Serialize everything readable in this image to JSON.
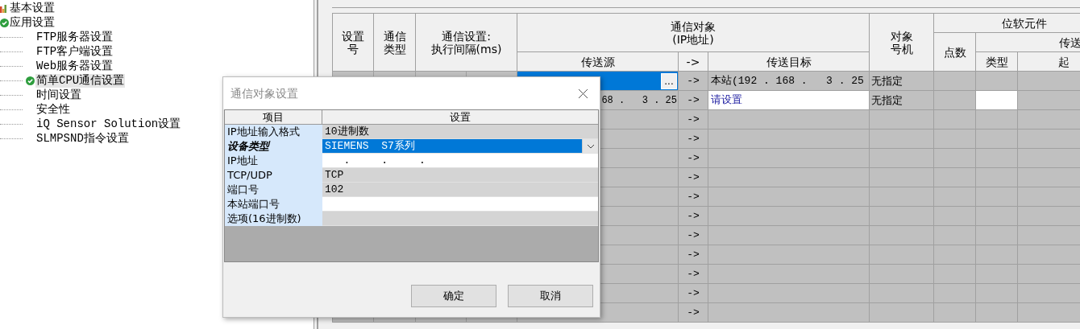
{
  "tree": [
    {
      "label": "基本设置",
      "kind": "chart",
      "selected": false
    },
    {
      "label": "应用设置",
      "kind": "check",
      "selected": false,
      "children": [
        {
          "label": "FTP服务器设置",
          "kind": "plain",
          "selected": false
        },
        {
          "label": "FTP客户端设置",
          "kind": "plain",
          "selected": false
        },
        {
          "label": "Web服务器设置",
          "kind": "plain",
          "selected": false
        },
        {
          "label": "简单CPU通信设置",
          "kind": "check",
          "selected": true
        },
        {
          "label": "时间设置",
          "kind": "plain",
          "selected": false
        },
        {
          "label": "安全性",
          "kind": "plain",
          "selected": false
        },
        {
          "label": "iQ Sensor Solution设置",
          "kind": "plain",
          "selected": false
        },
        {
          "label": "SLMPSND指令设置",
          "kind": "plain",
          "selected": false
        }
      ]
    }
  ],
  "grid": {
    "headers": {
      "setting_no": [
        "设置",
        "号"
      ],
      "comm_type": [
        "通信",
        "类型"
      ],
      "interval": [
        "通信设置:",
        "执行间隔(ms)"
      ],
      "target_group": [
        "通信对象",
        "(IP地址)"
      ],
      "station": [
        "对象",
        "号机"
      ],
      "bit_device": "位软元件",
      "points": "点数",
      "bit_source": "传送",
      "source": "传送源",
      "arrow": "->",
      "destination": "传送目标",
      "type": "类型",
      "start": "起"
    },
    "rows": [
      {
        "source": {
          "selected": true,
          "button": "..."
        },
        "arrow": "->",
        "destination": {
          "text": "本站(192 . 168 .   3 . 25",
          "editable": false,
          "unset": false
        },
        "station": "无指定",
        "type_editable": false
      },
      {
        "source": {
          "text": "68 .   3 . 25",
          "selected": false
        },
        "arrow": "->",
        "destination": {
          "text": "请设置",
          "editable": true,
          "unset": true
        },
        "station": "无指定",
        "type_editable": true
      },
      {
        "arrow": "->"
      },
      {
        "arrow": "->"
      },
      {
        "arrow": "->"
      },
      {
        "arrow": "->"
      },
      {
        "arrow": "->"
      },
      {
        "arrow": "->"
      },
      {
        "arrow": "->"
      },
      {
        "arrow": "->"
      },
      {
        "arrow": "->"
      },
      {
        "arrow": "->"
      },
      {
        "arrow": "->"
      }
    ]
  },
  "dialog": {
    "title": "通信对象设置",
    "columns": [
      "项目",
      "设置"
    ],
    "rows": [
      {
        "label": "IP地址输入格式",
        "value": "10进制数",
        "kind": "text",
        "editable": false,
        "emphasis": false
      },
      {
        "label": "设备类型",
        "value": "SIEMENS  S7系列",
        "kind": "dropdown",
        "emphasis": true,
        "selected": true
      },
      {
        "label": "IP地址",
        "value": "   .     .     .",
        "kind": "ip",
        "editable": true,
        "emphasis": false
      },
      {
        "label": "TCP/UDP",
        "value": "TCP",
        "kind": "text",
        "editable": false,
        "emphasis": false
      },
      {
        "label": "端口号",
        "value": "102",
        "kind": "text",
        "editable": false,
        "emphasis": false
      },
      {
        "label": "本站端口号",
        "kind": "text",
        "editable": true,
        "emphasis": false
      },
      {
        "label": "选项(16进制数)",
        "kind": "text",
        "editable": false,
        "emphasis": false
      }
    ],
    "buttons": [
      "确定",
      "取消"
    ]
  }
}
